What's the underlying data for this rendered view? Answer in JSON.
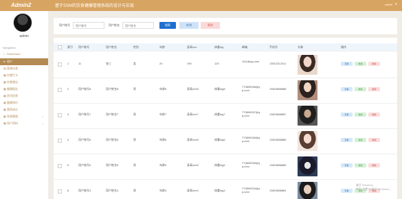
{
  "brand": {
    "logo_text": "Admin2"
  },
  "user": {
    "name": "admin"
  },
  "nav": {
    "label": "Navigation",
    "items": [
      {
        "label": "Dashboard",
        "icon": "home-icon",
        "glyph": "⌂"
      },
      {
        "label": "用户",
        "icon": "user-icon",
        "glyph": "●",
        "active": true
      },
      {
        "label": "菜谱分类",
        "icon": "list-icon",
        "glyph": "▤"
      },
      {
        "label": "饮食打卡",
        "icon": "grid-icon",
        "glyph": "▦"
      },
      {
        "label": "饮食建议",
        "icon": "grid-icon",
        "glyph": "▦"
      },
      {
        "label": "健康报告",
        "icon": "grid-icon",
        "glyph": "▦"
      },
      {
        "label": "资讯信息",
        "icon": "grid-icon",
        "glyph": "▦"
      },
      {
        "label": "健康知识",
        "icon": "grid-icon",
        "glyph": "▦"
      },
      {
        "label": "营养成分",
        "icon": "grid-icon",
        "glyph": "▦"
      },
      {
        "label": "系统管理",
        "icon": "grid-icon",
        "glyph": "▦",
        "expandable": true
      },
      {
        "label": "用户资料",
        "icon": "grid-icon",
        "glyph": "▦",
        "expandable": true
      }
    ]
  },
  "header": {
    "title": "基于SSM的饮食健康管理系统的设计与实现",
    "user": "admin",
    "arrow": "▸"
  },
  "search": {
    "field1_label": "用户账号",
    "field1_placeholder": "用户账号",
    "field2_label": "用户姓名",
    "field2_placeholder": "用户姓名",
    "search_btn": "搜索",
    "add_btn": "新增",
    "delete_btn": "删除"
  },
  "table": {
    "columns": [
      "",
      "索引",
      "用户账号",
      "用户姓名",
      "性别",
      "年龄",
      "身高/cm",
      "体重/kg",
      "邮箱",
      "手机号",
      "头像",
      "操作"
    ],
    "action_labels": {
      "view": "查看",
      "edit": "修改",
      "delete": "删除"
    },
    "rows": [
      {
        "idx": "1",
        "account": "11",
        "name": "张三",
        "gender": "女",
        "age": "20",
        "height": "190",
        "weight": "120",
        "email": "1111@qq.com",
        "phone": "13512312311"
      },
      {
        "idx": "2",
        "account": "用户账号8",
        "name": "用户姓名8",
        "gender": "男",
        "age": "年龄8",
        "height": "身高/cm8",
        "weight": "体重/kg8",
        "email": "773890008@q\nq.com",
        "phone": "13823888888"
      },
      {
        "idx": "3",
        "account": "用户账号7",
        "name": "用户姓名7",
        "gender": "男",
        "age": "年龄7",
        "height": "身高/cm7",
        "weight": "体重/kg7",
        "email": "773890007@q\nq.com",
        "phone": "13823888887"
      },
      {
        "idx": "4",
        "account": "用户账号6",
        "name": "用户姓名6",
        "gender": "男",
        "age": "年龄6",
        "height": "身高/cm6",
        "weight": "体重/kg6",
        "email": "773890006@q\nq.com",
        "phone": "13823888886"
      },
      {
        "idx": "5",
        "account": "用户账号5",
        "name": "用户姓名5",
        "gender": "男",
        "age": "年龄5",
        "height": "身高/cm5",
        "weight": "体重/kg5",
        "email": "773890005@q\nq.com",
        "phone": "13823888885"
      },
      {
        "idx": "6",
        "account": "用户账号4",
        "name": "用户姓名4",
        "gender": "男",
        "age": "年龄4",
        "height": "身高/cm4",
        "weight": "体重/kg4",
        "email": "773890004@q\nq.com",
        "phone": "13823888884"
      }
    ]
  },
  "watermark": "激活 Windows\n转到\"设置\"以激活 Windows。",
  "colors": {
    "brand": "#d8a461",
    "nav_active": "#b38a53",
    "search_btn": "#1e6fcf",
    "add_btn": "#cfe3f8",
    "delete_btn": "#fbd9d9"
  }
}
